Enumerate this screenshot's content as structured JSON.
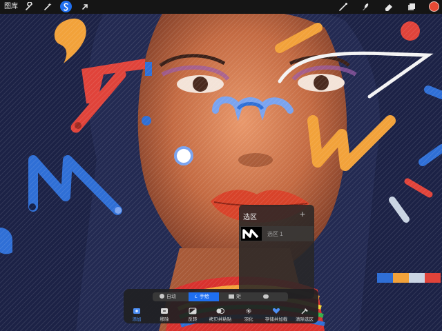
{
  "topbar": {
    "gallery_label": "图库",
    "left_tools": [
      "wrench-icon",
      "magic-wand-icon",
      "selection-icon",
      "transform-arrow-icon"
    ],
    "right_tools": [
      "brush-icon",
      "smudge-icon",
      "eraser-icon",
      "layers-icon"
    ],
    "active_tool": "selection-icon",
    "current_color": "#e64a34"
  },
  "selection_panel": {
    "title": "选区",
    "add_label": "+",
    "items": [
      {
        "label": "选区 1"
      }
    ]
  },
  "selection_toolbar": {
    "modes": [
      {
        "label": "自动",
        "active": false
      },
      {
        "label": "手绘",
        "active": true
      },
      {
        "label": "矩",
        "active": false
      },
      {
        "label": "",
        "active": false
      }
    ],
    "actions": [
      {
        "label": "添加",
        "icon": "add-icon",
        "primary": true
      },
      {
        "label": "移除",
        "icon": "remove-icon"
      },
      {
        "label": "反转",
        "icon": "invert-icon"
      },
      {
        "label": "拷贝并粘贴",
        "icon": "copy-paste-icon"
      },
      {
        "label": "羽化",
        "icon": "feather-icon"
      },
      {
        "label": "存储并加载",
        "icon": "save-load-icon"
      },
      {
        "label": "清除选区",
        "icon": "clear-selection-icon"
      }
    ]
  },
  "palette": [
    "#2f6fd6",
    "#f2a23a",
    "#c9d4e3",
    "#e0433a"
  ],
  "accent": "#1f6ff0"
}
